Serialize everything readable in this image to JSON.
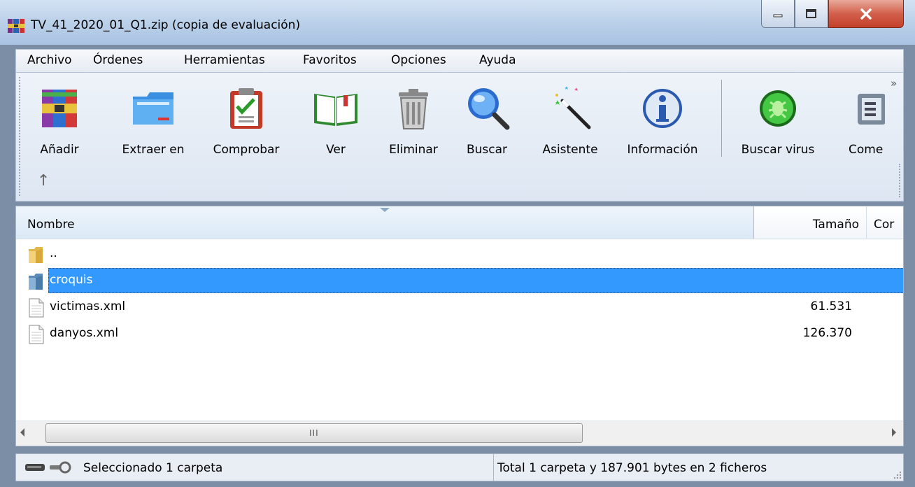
{
  "window": {
    "title": "TV_41_2020_01_Q1.zip (copia de evaluación)"
  },
  "menu": [
    "Archivo",
    "Órdenes",
    "Herramientas",
    "Favoritos",
    "Opciones",
    "Ayuda"
  ],
  "toolbar": {
    "buttons": [
      {
        "label": "Añadir",
        "icon": "add-archive-icon"
      },
      {
        "label": "Extraer en",
        "icon": "extract-folder-icon"
      },
      {
        "label": "Comprobar",
        "icon": "test-clipboard-icon"
      },
      {
        "label": "Ver",
        "icon": "view-book-icon"
      },
      {
        "label": "Eliminar",
        "icon": "trash-icon"
      },
      {
        "label": "Buscar",
        "icon": "magnifier-icon"
      },
      {
        "label": "Asistente",
        "icon": "wizard-wand-icon"
      },
      {
        "label": "Información",
        "icon": "info-icon"
      },
      {
        "label": "Buscar virus",
        "icon": "virus-scan-icon"
      },
      {
        "label": "Come",
        "icon": "comment-icon"
      }
    ],
    "up_arrow": "↑",
    "overflow": "»"
  },
  "list": {
    "columns": {
      "name": "Nombre",
      "size": "Tamaño",
      "third": "Cor"
    },
    "rows": [
      {
        "name": "..",
        "size": "",
        "type": "folder-up"
      },
      {
        "name": "croquis",
        "size": "",
        "type": "folder",
        "selected": true
      },
      {
        "name": "victimas.xml",
        "size": "61.531",
        "type": "file"
      },
      {
        "name": "danyos.xml",
        "size": "126.370",
        "type": "file"
      }
    ],
    "scroll_grip": "III"
  },
  "status": {
    "left": "Seleccionado 1 carpeta",
    "right": "Total 1 carpeta y 187.901 bytes en 2 ficheros"
  },
  "colors": {
    "selection": "#3399ff",
    "close_button": "#c4402a",
    "titlebar": "#bdd2ea"
  }
}
